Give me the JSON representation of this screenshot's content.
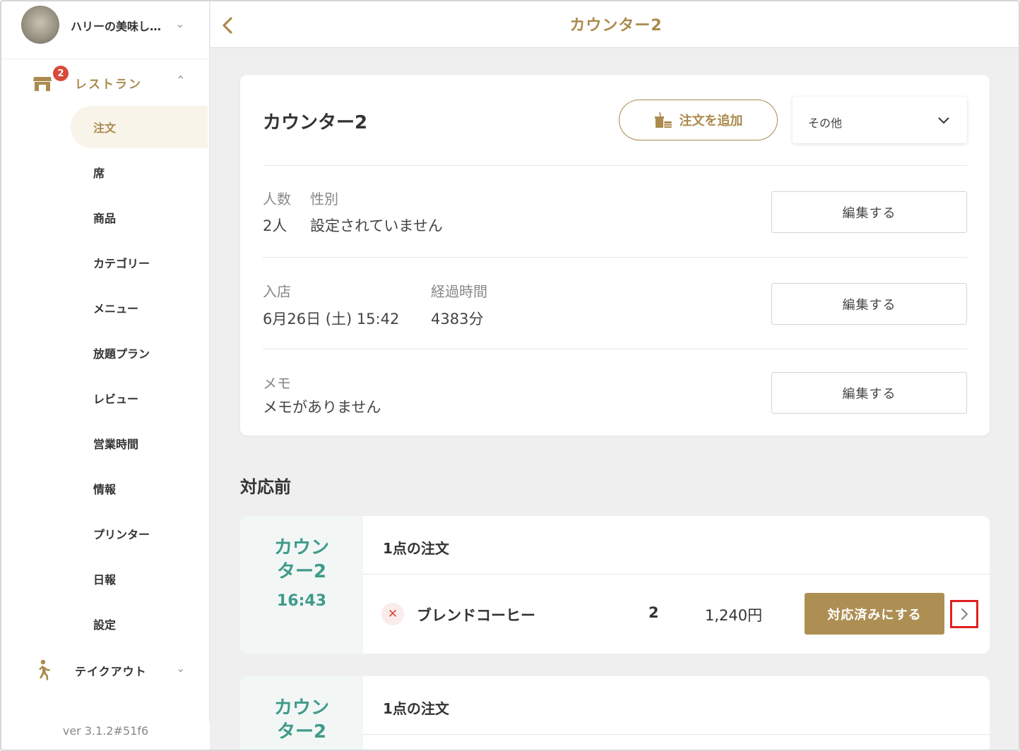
{
  "account": {
    "name": "ハリーの美味し…"
  },
  "sidebar": {
    "group": {
      "label": "レストラン",
      "badge": "2"
    },
    "items": [
      {
        "label": "注文",
        "active": true
      },
      {
        "label": "席"
      },
      {
        "label": "商品"
      },
      {
        "label": "カテゴリー"
      },
      {
        "label": "メニュー"
      },
      {
        "label": "放題プラン"
      },
      {
        "label": "レビュー"
      },
      {
        "label": "営業時間"
      },
      {
        "label": "情報"
      },
      {
        "label": "プリンター"
      },
      {
        "label": "日報"
      },
      {
        "label": "設定"
      }
    ],
    "takeout": {
      "label": "テイクアウト"
    },
    "version": "ver 3.1.2#51f6"
  },
  "topbar": {
    "title": "カウンター2"
  },
  "card": {
    "title": "カウンター2",
    "add_order_label": "注文を追加",
    "more_label": "その他",
    "people_label": "人数",
    "gender_label": "性別",
    "people_value": "2人",
    "gender_value": "設定されていません",
    "checkin_label": "入店",
    "elapsed_label": "経過時間",
    "checkin_value": "6月26日 (土) 15:42",
    "elapsed_value": "4383分",
    "memo_label": "メモ",
    "memo_value": "メモがありません",
    "edit_label": "編集する"
  },
  "section": {
    "title": "対応前"
  },
  "orders": [
    {
      "seat": "カウンター2",
      "seat_line1": "カウン",
      "seat_line2": "ター2",
      "time": "16:43",
      "head": "1点の注文",
      "item_name": "ブレンドコーヒー",
      "qty": "2",
      "price": "1,240円",
      "done_label": "対応済みにする"
    },
    {
      "seat_line1": "カウン",
      "seat_line2": "ター2",
      "head": "1点の注文"
    }
  ],
  "colors": {
    "brand": "#ab8a4e",
    "teal": "#3f9a8a",
    "alert": "#d9493a"
  }
}
